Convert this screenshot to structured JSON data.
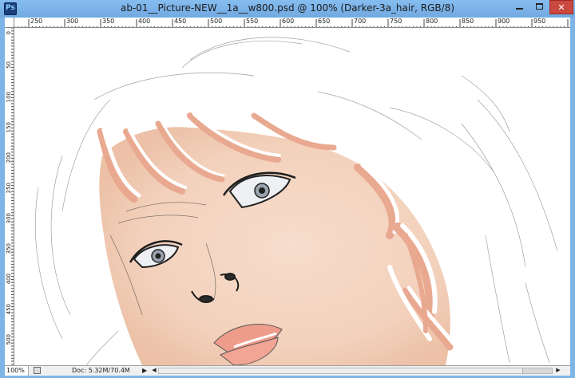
{
  "window": {
    "title": "ab-01__Picture-NEW__1a__w800.psd @ 100% (Darker-3a_hair, RGB/8)",
    "minimize_icon": "minimize-icon",
    "maximize_icon": "maximize-icon",
    "close_icon": "close-icon"
  },
  "rulers": {
    "horizontal_labels": [
      "250",
      "300",
      "350",
      "400",
      "450",
      "500",
      "550",
      "600",
      "650",
      "700",
      "750",
      "800",
      "850",
      "900",
      "950"
    ],
    "vertical_labels": [
      "0",
      "50",
      "100",
      "150",
      "200",
      "250",
      "300",
      "350",
      "400",
      "450",
      "500"
    ]
  },
  "canvas": {
    "description_icon": "portrait-sketch-artwork",
    "skin_color": "#f3d3bf",
    "hair_stroke_color": "#e9a990",
    "lips_color": "#ee9c8b"
  },
  "statusbar": {
    "zoom": "100%",
    "doc_info": "Doc: 5.32M/70.4M",
    "arrow_icon": "play-arrow-icon",
    "scroll_left_icon": "scroll-left-icon",
    "scroll_right_icon": "scroll-right-icon"
  },
  "colors": {
    "titlebar": "#7eb4e6",
    "close_button": "#c9483f"
  }
}
